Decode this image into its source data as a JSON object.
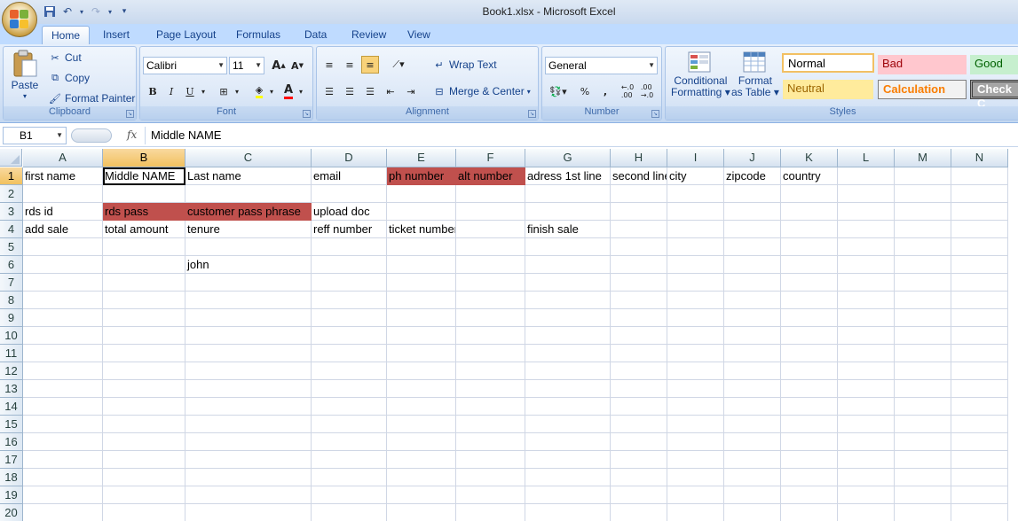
{
  "window": {
    "title": "Book1.xlsx - Microsoft Excel"
  },
  "tabs": [
    "Home",
    "Insert",
    "Page Layout",
    "Formulas",
    "Data",
    "Review",
    "View"
  ],
  "ribbon": {
    "clipboard": {
      "label": "Clipboard",
      "paste": "Paste",
      "cut": "Cut",
      "copy": "Copy",
      "format_painter": "Format Painter"
    },
    "font": {
      "label": "Font",
      "name": "Calibri",
      "size": "11",
      "bold": "B",
      "italic": "I",
      "underline": "U"
    },
    "alignment": {
      "label": "Alignment",
      "wrap_text": "Wrap Text",
      "merge_center": "Merge & Center"
    },
    "number": {
      "label": "Number",
      "format": "General",
      "percent": "%",
      "comma": ","
    },
    "styles": {
      "label": "Styles",
      "conditional": "Conditional",
      "formatting": "Formatting",
      "format": "Format",
      "as_table": "as Table",
      "cells": [
        {
          "text": "Normal",
          "bg": "#ffffff",
          "fg": "#000000"
        },
        {
          "text": "Bad",
          "bg": "#ffc7ce",
          "fg": "#9c0006"
        },
        {
          "text": "Good",
          "bg": "#c6efce",
          "fg": "#006100"
        },
        {
          "text": "Neutral",
          "bg": "#ffeb9c",
          "fg": "#9c6500"
        },
        {
          "text": "Calculation",
          "bg": "#f2f2f2",
          "fg": "#fa7d00"
        },
        {
          "text": "Check C",
          "bg": "#a5a5a5",
          "fg": "#ffffff"
        }
      ]
    }
  },
  "formula_bar": {
    "name_box": "B1",
    "fx": "fx",
    "content": "Middle NAME"
  },
  "columns": [
    "A",
    "B",
    "C",
    "D",
    "E",
    "F",
    "G",
    "H",
    "I",
    "J",
    "K",
    "L",
    "M",
    "N"
  ],
  "rows": [
    "1",
    "2",
    "3",
    "4",
    "5",
    "6",
    "7",
    "8",
    "9",
    "10",
    "11",
    "12",
    "13",
    "14",
    "15",
    "16",
    "17",
    "18",
    "19",
    "20"
  ],
  "cells": [
    {
      "ref": "A1",
      "text": "first name"
    },
    {
      "ref": "B1",
      "text": "Middle NAME"
    },
    {
      "ref": "C1",
      "text": "Last name"
    },
    {
      "ref": "D1",
      "text": "email"
    },
    {
      "ref": "E1",
      "text": "ph number",
      "fill": "#c0504d"
    },
    {
      "ref": "F1",
      "text": "alt number",
      "fill": "#c0504d"
    },
    {
      "ref": "G1",
      "text": "adress 1st line"
    },
    {
      "ref": "H1",
      "text": "second line"
    },
    {
      "ref": "I1",
      "text": "city"
    },
    {
      "ref": "J1",
      "text": "zipcode"
    },
    {
      "ref": "K1",
      "text": "country"
    },
    {
      "ref": "A3",
      "text": "rds id"
    },
    {
      "ref": "B3",
      "text": "rds pass",
      "fill": "#c0504d"
    },
    {
      "ref": "C3",
      "text": "customer pass phrase",
      "fill": "#c0504d"
    },
    {
      "ref": "D3",
      "text": "upload doc"
    },
    {
      "ref": "A4",
      "text": "add sale"
    },
    {
      "ref": "B4",
      "text": "total amount"
    },
    {
      "ref": "C4",
      "text": "tenure"
    },
    {
      "ref": "D4",
      "text": "reff number"
    },
    {
      "ref": "E4",
      "text": "ticket number"
    },
    {
      "ref": "G4",
      "text": "finish sale"
    },
    {
      "ref": "C6",
      "text": "john"
    }
  ],
  "selection": {
    "cell": "B1",
    "column": "B",
    "row": "1"
  }
}
